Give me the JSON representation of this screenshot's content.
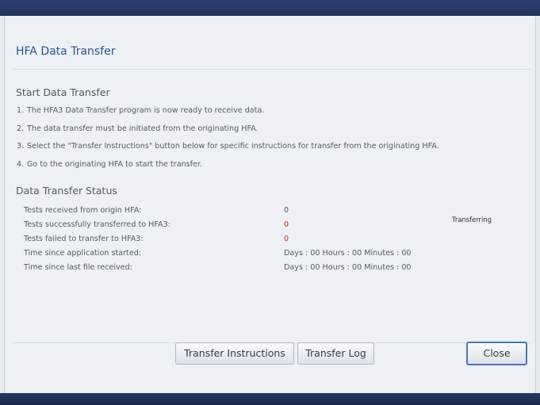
{
  "dialog": {
    "title": "HFA Data Transfer"
  },
  "start_section": {
    "heading": "Start Data Transfer",
    "steps": [
      {
        "num": "1.",
        "text": "The HFA3 Data Transfer program is now ready to receive data."
      },
      {
        "num": "2.",
        "text": "The data transfer must be initiated from the originating HFA."
      },
      {
        "num": "3.",
        "text": "Select the \"Transfer Instructions\" button below for specific instructions for transfer from the originating HFA."
      },
      {
        "num": "4.",
        "text": "Go to the originating HFA to start the transfer."
      }
    ]
  },
  "status_section": {
    "heading": "Data Transfer Status",
    "rows": [
      {
        "label": "Tests received from origin HFA:",
        "value": "0"
      },
      {
        "label": "Tests successfully transferred to HFA3:",
        "value": "0"
      },
      {
        "label": "Tests failed to transfer to HFA3:",
        "value": "0"
      },
      {
        "label": "Time since application started:",
        "value": "Days : 00 Hours : 00 Minutes : 00"
      },
      {
        "label": "Time since last file received:",
        "value": "Days : 00 Hours : 00 Minutes : 00"
      }
    ],
    "state": "Transferring"
  },
  "buttons": {
    "transfer_instructions": "Transfer Instructions",
    "transfer_log": "Transfer Log",
    "close": "Close"
  },
  "colors": {
    "title": "#2d5595",
    "error_value": "#d8302b",
    "frame": "#22335f",
    "dialog_background": "#edf0f4"
  }
}
